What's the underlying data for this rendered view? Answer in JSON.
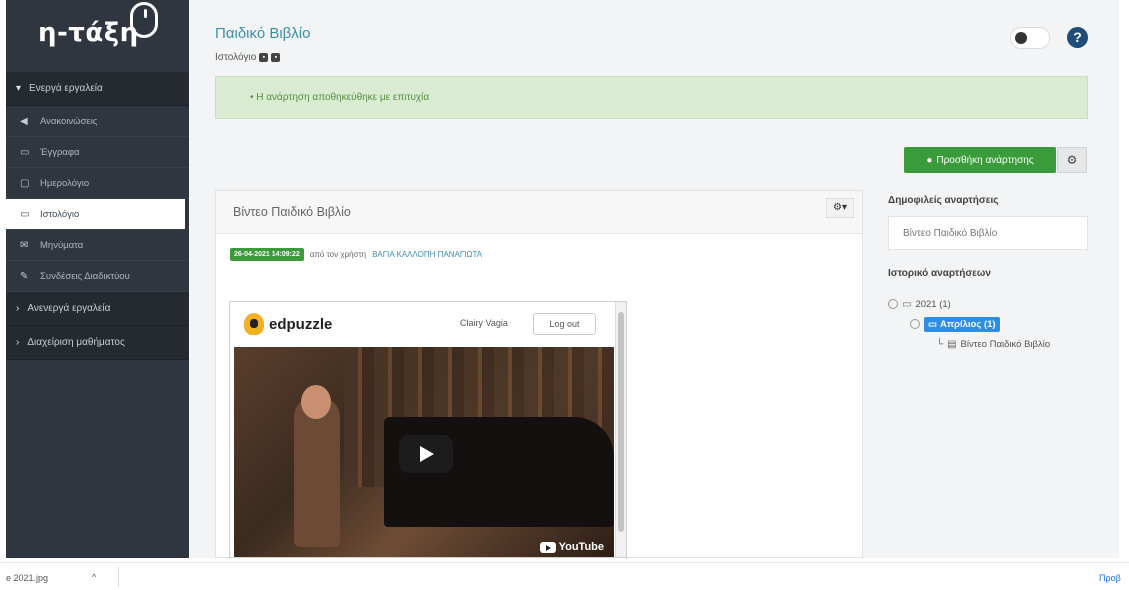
{
  "sidebar": {
    "logo": "η-τάξη",
    "sections": [
      {
        "label": "Ενεργά εργαλεία",
        "expanded": true
      },
      {
        "label": "Ανενεργά εργαλεία",
        "expanded": false
      },
      {
        "label": "Διαχείριση μαθήματος",
        "expanded": false
      }
    ],
    "items": [
      {
        "icon": "megaphone-icon",
        "label": "Ανακοινώσεις"
      },
      {
        "icon": "folder-icon",
        "label": "Έγγραφα"
      },
      {
        "icon": "calendar-icon",
        "label": "Ημερολόγιο"
      },
      {
        "icon": "blog-icon",
        "label": "Ιστολόγιο"
      },
      {
        "icon": "envelope-icon",
        "label": "Μηνύματα"
      },
      {
        "icon": "link-icon",
        "label": "Συνδέσεις Διαδικτύου"
      }
    ],
    "active_item": "Ιστολόγιο"
  },
  "header": {
    "title": "Παιδικό Βιβλίο",
    "breadcrumb": "Ιστολόγιο"
  },
  "alert": {
    "message": "• Η ανάρτηση αποθηκεύθηκε με επιτυχία"
  },
  "toolbar": {
    "add_post_label": "Προσθήκη ανάρτησης",
    "help_label": "?"
  },
  "post": {
    "title": "Βίντεο Παιδικό Βιβλίο",
    "date": "26-04-2021 14:09:22",
    "by_text": "από τον χρήστη",
    "author": "ΒΑΓΙΑ ΚΑΛΛΟΠΗ ΠΑΝΑΓΙΩΤΑ",
    "embed": {
      "brand": "edpuzzle",
      "user": "Clairy Vagia",
      "logout_label": "Log out",
      "player_label": "YouTube"
    }
  },
  "right": {
    "popular_heading": "Δημοφιλείς αναρτήσεις",
    "popular_item": "Βίντεο Παιδικό Βιβλίο",
    "history_heading": "Ιστορικό αναρτήσεων",
    "tree": {
      "year": "2021 (1)",
      "month": "Απρίλιος (1)",
      "post": "Βίντεο Παιδικό Βιβλίο"
    }
  },
  "downloads": {
    "file": "e 2021.jpg",
    "show_all": "Προβ"
  },
  "colors": {
    "sidebar": "#2f3640",
    "accent": "#3d8fae",
    "success": "#3a9b3a",
    "alert_bg": "#d9ecd2"
  }
}
